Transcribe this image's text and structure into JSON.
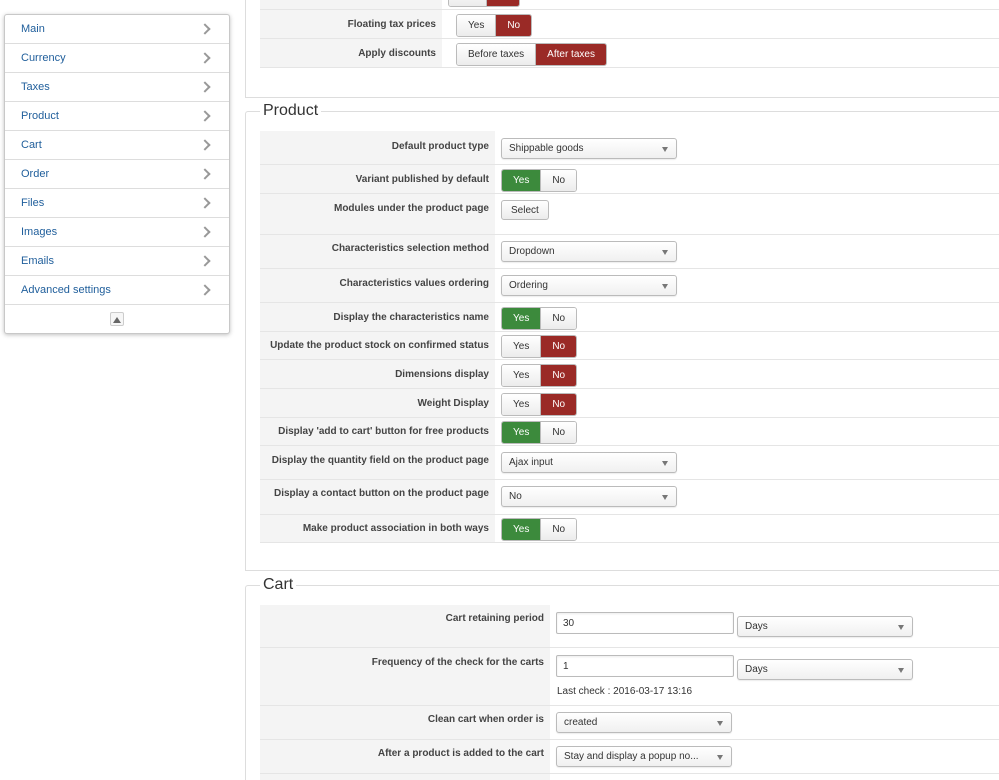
{
  "sidebar": {
    "items": [
      {
        "label": "Main"
      },
      {
        "label": "Currency"
      },
      {
        "label": "Taxes"
      },
      {
        "label": "Product"
      },
      {
        "label": "Cart"
      },
      {
        "label": "Order"
      },
      {
        "label": "Files"
      },
      {
        "label": "Images"
      },
      {
        "label": "Emails"
      },
      {
        "label": "Advanced settings"
      }
    ]
  },
  "taxes": {
    "floating_label": "Floating tax prices",
    "floating_yes": "Yes",
    "floating_no": "No",
    "discounts_label": "Apply discounts",
    "discounts_before": "Before taxes",
    "discounts_after": "After taxes"
  },
  "product": {
    "legend": "Product",
    "default_type_label": "Default product type",
    "default_type_value": "Shippable goods",
    "variant_label": "Variant published by default",
    "modules_label": "Modules under the product page",
    "modules_button": "Select",
    "char_method_label": "Characteristics selection method",
    "char_method_value": "Dropdown",
    "char_order_label": "Characteristics values ordering",
    "char_order_value": "Ordering",
    "char_name_label": "Display the characteristics name",
    "stock_label": "Update the product stock on confirmed status",
    "dimensions_label": "Dimensions display",
    "weight_label": "Weight Display",
    "free_cart_label": "Display 'add to cart' button for free products",
    "qty_label": "Display the quantity field on the product page",
    "qty_value": "Ajax input",
    "contact_label": "Display a contact button on the product page",
    "contact_value": "No",
    "assoc_label": "Make product association in both ways",
    "yes": "Yes",
    "no": "No"
  },
  "cart": {
    "legend": "Cart",
    "retain_label": "Cart retaining period",
    "retain_value": "30",
    "retain_unit": "Days",
    "freq_label": "Frequency of the check for the carts",
    "freq_value": "1",
    "freq_unit": "Days",
    "last_check": "Last check : 2016-03-17 13:16",
    "clean_label": "Clean cart when order is",
    "clean_value": "created",
    "after_add_label": "After a product is added to the cart",
    "after_add_value": "Stay and display a popup no..."
  },
  "colors": {
    "yes_active": "#3c8a3c",
    "no_active": "#9a2a26",
    "link": "#1f5e9b"
  }
}
